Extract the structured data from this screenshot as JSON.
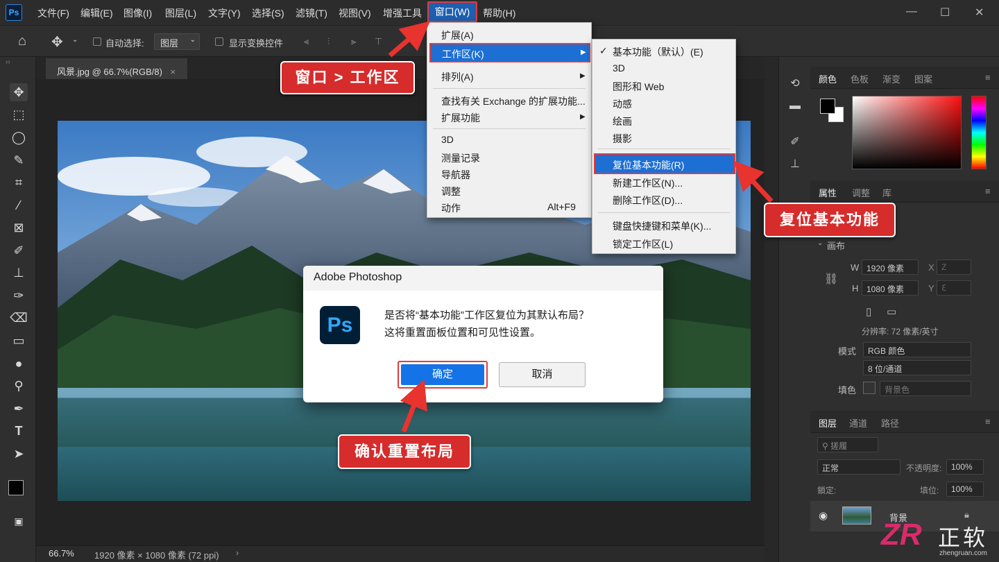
{
  "menubar": {
    "logo": "Ps",
    "items": [
      "文件(F)",
      "编辑(E)",
      "图像(I)",
      "图层(L)",
      "文字(Y)",
      "选择(S)",
      "滤镜(T)",
      "视图(V)",
      "增强工具",
      "窗口(W)",
      "帮助(H)"
    ],
    "window_controls": [
      "—",
      "☐",
      "✕"
    ]
  },
  "options_bar": {
    "auto_select_label": "自动选择:",
    "layer_select_value": "图层",
    "show_transform_label": "显示变换控件"
  },
  "document": {
    "tab_label": "风景.jpg @ 66.7%(RGB/8)",
    "tab_close": "×"
  },
  "status": {
    "zoom": "66.7%",
    "info": "1920 像素 × 1080 像素 (72 ppi)",
    "arrow": "›"
  },
  "window_menu": {
    "items": [
      "扩展(A)",
      "工作区(K)",
      "排列(A)",
      "查找有关 Exchange 的扩展功能...",
      "扩展功能",
      "3D",
      "测量记录",
      "导航器",
      "调整",
      "动作"
    ],
    "action_shortcut": "Alt+F9"
  },
  "workspace_menu": {
    "items": [
      "基本功能（默认）(E)",
      "3D",
      "图形和 Web",
      "动感",
      "绘画",
      "摄影",
      "复位基本功能(R)",
      "新建工作区(N)...",
      "删除工作区(D)...",
      "键盘快捷键和菜单(K)...",
      "锁定工作区(L)"
    ],
    "checkmark": "✓"
  },
  "dialog": {
    "title": "Adobe Photoshop",
    "icon_text": "Ps",
    "line1": "是否将“基本功能”工作区复位为其默认布局？",
    "line2": "这将重置面板位置和可见性设置。",
    "ok": "确定",
    "cancel": "取消"
  },
  "callouts": {
    "window_workspace": "窗口 > 工作区",
    "reset_basic": "复位基本功能",
    "confirm_reset": "确认重置布局"
  },
  "color_panel": {
    "tabs": [
      "颜色",
      "色板",
      "渐变",
      "图案"
    ]
  },
  "properties_panel": {
    "tabs": [
      "属性",
      "调整",
      "库"
    ],
    "section": "画布",
    "w_label": "W",
    "w_value": "1920 像素",
    "x_label": "X",
    "x_value": "Z",
    "h_label": "H",
    "h_value": "1080 像素",
    "y_label": "Y",
    "y_value": "ℇ",
    "resolution": "分辨率: 72 像素/英寸",
    "mode_label": "模式",
    "mode_value": "RGB 颜色",
    "depth_value": "8 位/通道",
    "fill_label": "填色",
    "fill_value": "背景色"
  },
  "layers_panel": {
    "tabs": [
      "图层",
      "通道",
      "路径"
    ],
    "filter_placeholder": "搓履",
    "blend_mode": "正常",
    "opacity_label": "不透明度:",
    "opacity_value": "100%",
    "lock_label": "鎖定:",
    "fill_label": "填位:",
    "fill_value": "100%",
    "layer_name": "背景"
  },
  "watermark": {
    "logo": "ZR",
    "name": "正软",
    "url": "zhengruan.com"
  },
  "colors": {
    "accent_blue": "#1d6fd3",
    "highlight_red": "#e23b3b",
    "callout_red": "#d62c2c",
    "ui_dark": "#2f2f2f"
  }
}
